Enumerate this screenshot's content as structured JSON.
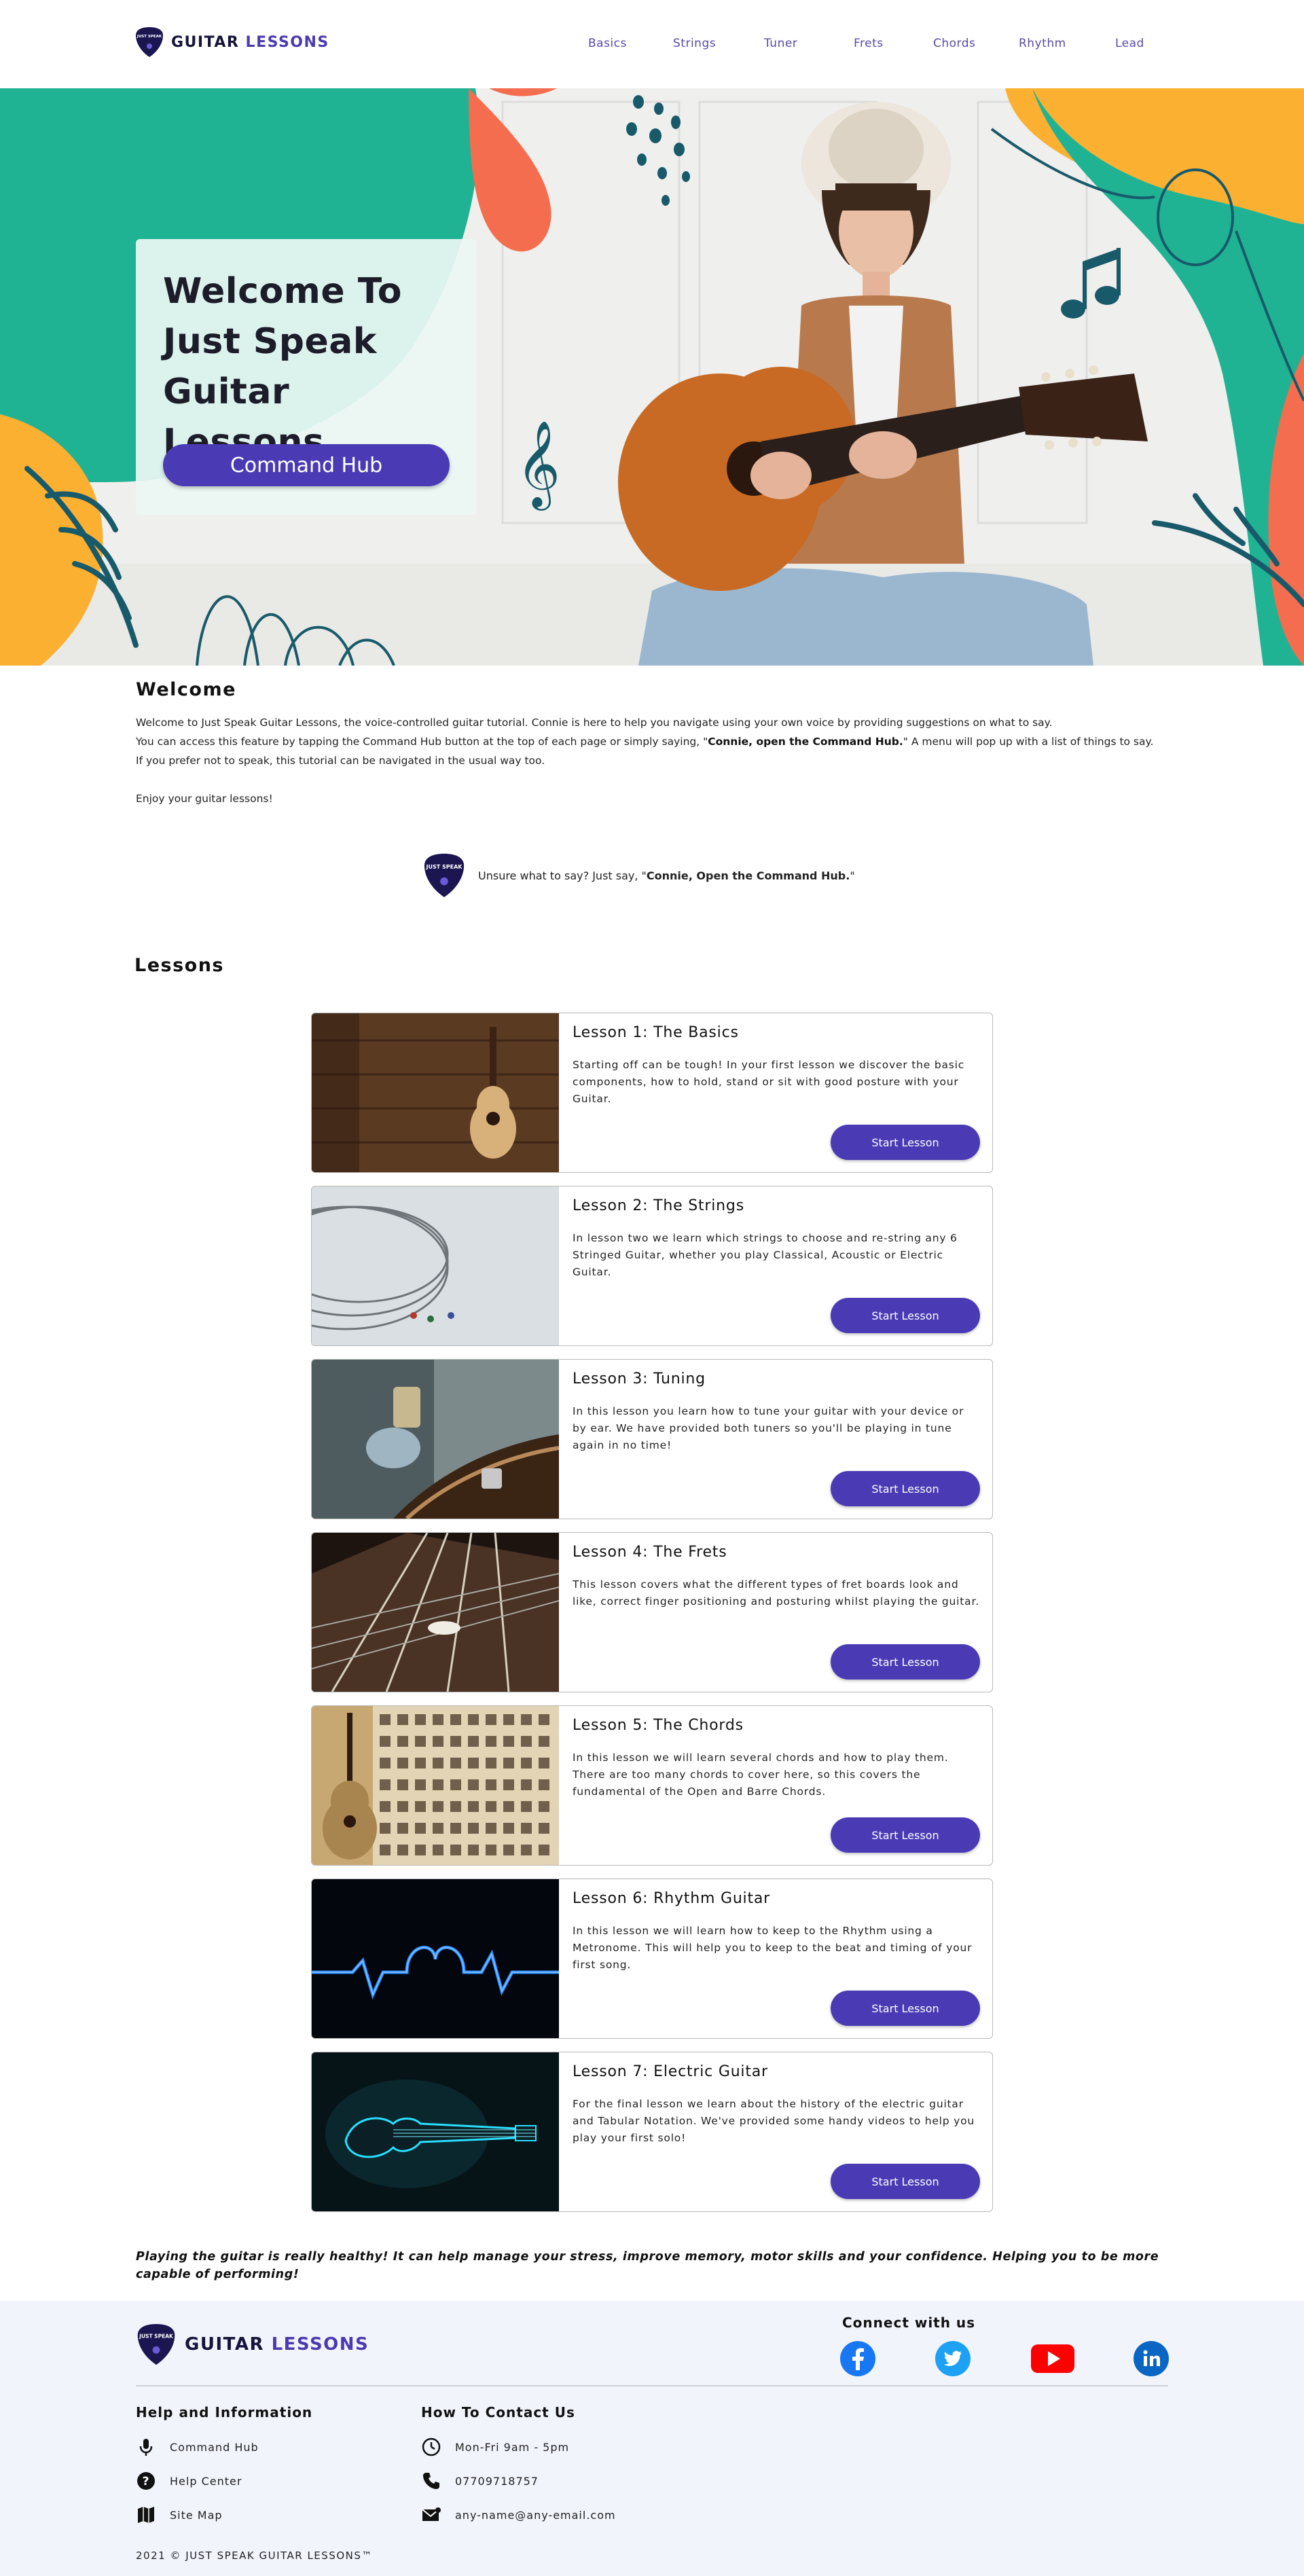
{
  "header": {
    "logo": {
      "word1": "GUITAR",
      "word2": "LESSONS",
      "pick_text": "JUST SPEAK"
    },
    "nav": [
      "Basics",
      "Strings",
      "Tuner",
      "Frets",
      "Chords",
      "Rhythm",
      "Lead"
    ]
  },
  "hero": {
    "title_line1": "Welcome To",
    "title_line2": "Just Speak",
    "title_line3": "Guitar Lessons",
    "button": "Command Hub"
  },
  "welcome": {
    "heading": "Welcome",
    "line1": "Welcome to Just Speak Guitar Lessons, the voice-controlled guitar tutorial. Connie is here to help you navigate using your own voice by providing suggestions on what to say.",
    "line2_pre": "You can access this feature by tapping the Command Hub button at the top of each page or simply saying, \"",
    "line2_bold": "Connie, open the Command Hub.",
    "line2_post": "\" A menu will pop up with a list of things to say.",
    "line3": "If you prefer not to speak, this tutorial can be navigated in the usual way too.",
    "line4": "Enjoy your guitar lessons!",
    "hint_pre": "Unsure what to say? Just say, \"",
    "hint_bold": "Connie, Open the Command Hub.",
    "hint_post": "\""
  },
  "lessons_heading": "Lessons",
  "lessons": [
    {
      "title": "Lesson 1: The Basics",
      "desc": "Starting off can be tough! In your first lesson we discover the basic components, how to hold, stand or sit with good posture with your Guitar.",
      "button": "Start Lesson"
    },
    {
      "title": "Lesson 2: The Strings",
      "desc": "In lesson two we learn which strings to choose and re-string any 6 Stringed Guitar, whether you play Classical, Acoustic or Electric Guitar.",
      "button": "Start Lesson"
    },
    {
      "title": "Lesson 3: Tuning",
      "desc": "In this lesson you learn how to tune your guitar with your device or by ear. We have provided both tuners so you'll be playing in tune again in no time!",
      "button": "Start Lesson"
    },
    {
      "title": "Lesson 4: The Frets",
      "desc": "This lesson covers what the different types of fret boards look and like, correct finger positioning and posturing whilst playing the guitar.",
      "button": "Start Lesson"
    },
    {
      "title": "Lesson 5: The Chords",
      "desc": "In this lesson we will learn several chords and how to play them. There are too many chords to cover here, so this covers the fundamental of the Open and Barre Chords.",
      "button": "Start Lesson"
    },
    {
      "title": "Lesson 6: Rhythm Guitar",
      "desc": "In this lesson we will learn how to keep to the Rhythm using a Metronome. This will help you to keep to the beat and timing of your first song.",
      "button": "Start Lesson"
    },
    {
      "title": "Lesson 7: Electric Guitar",
      "desc": "For the final lesson we learn about the history of the electric guitar and Tabular Notation. We've provided some handy videos to help you play your first solo!",
      "button": "Start Lesson"
    }
  ],
  "quote": "Playing the guitar is really healthy! It can help manage your stress, improve memory, motor skills and your confidence. Helping you to be more capable of performing!",
  "footer": {
    "connect": "Connect with us",
    "social": [
      "facebook-icon",
      "twitter-icon",
      "youtube-icon",
      "linkedin-icon"
    ],
    "help_heading": "Help and Information",
    "help_items": [
      "Command Hub",
      "Help Center",
      "Site Map"
    ],
    "contact_heading": "How To Contact Us",
    "contact_items": [
      "Mon-Fri 9am - 5pm",
      "07709718757",
      "any-name@any-email.com"
    ],
    "copyright": "2021 © JUST SPEAK GUITAR LESSONS™"
  },
  "colors": {
    "accent": "#4a3bb5",
    "teal": "#1fb394",
    "orange": "#fbb032",
    "coral": "#f56d4f"
  }
}
